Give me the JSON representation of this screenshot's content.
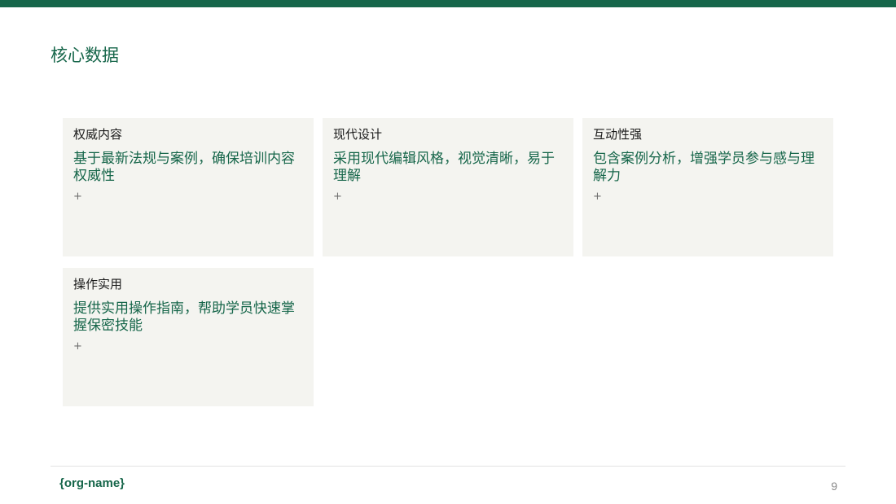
{
  "title": "核心数据",
  "cards": [
    {
      "title": "权威内容",
      "desc": "基于最新法规与案例，确保培训内容权威性",
      "plus": "+"
    },
    {
      "title": "现代设计",
      "desc": "采用现代编辑风格，视觉清晰，易于理解",
      "plus": "+"
    },
    {
      "title": "互动性强",
      "desc": "包含案例分析，增强学员参与感与理解力",
      "plus": "+"
    },
    {
      "title": "操作实用",
      "desc": "提供实用操作指南，帮助学员快速掌握保密技能",
      "plus": "+"
    }
  ],
  "footer": {
    "org_name": "{org-name}",
    "page_number": "9"
  },
  "colors": {
    "accent": "#16664a",
    "card_background": "#f4f4f0"
  }
}
